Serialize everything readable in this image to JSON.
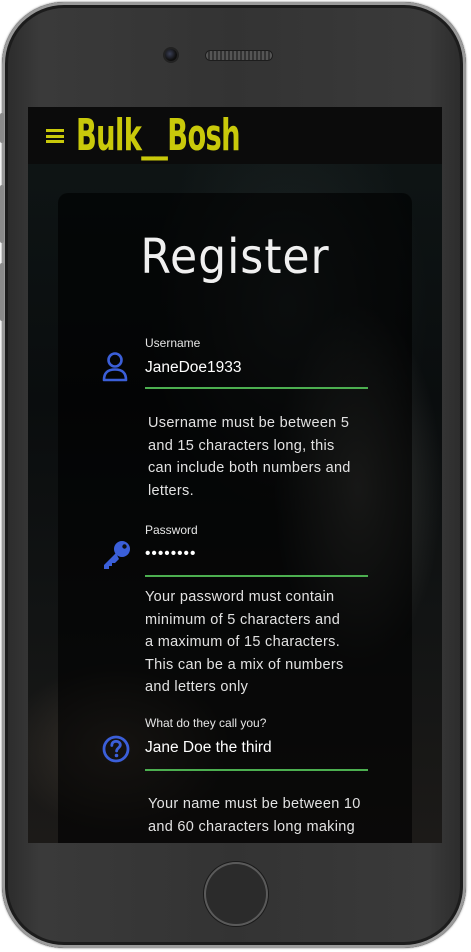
{
  "brand": "Bulk__Bosh",
  "page_title": "Register",
  "form": {
    "username": {
      "label": "Username",
      "value": "JaneDoe1933",
      "hint_lines": [
        "Username must be between 5",
        "and 15 characters long, this",
        "can include both numbers and",
        "letters."
      ]
    },
    "password": {
      "label": "Password",
      "value": "••••••••",
      "hint_lines": [
        "Your password must contain",
        "minimum of 5 characters and",
        "a maximum of 15 characters.",
        "This can be a mix of numbers",
        "and letters only"
      ]
    },
    "name": {
      "label": "What do they call you?",
      "value": "Jane Doe the third",
      "hint_lines": [
        "Your name must be between 10",
        "and 60 characters long making"
      ]
    }
  },
  "colors": {
    "brand": "#c9c90a",
    "icon": "#3b5fd9",
    "underline": "#4caf50"
  },
  "icons": {
    "menu": "hamburger-menu-icon",
    "username": "user-icon",
    "password": "key-icon",
    "name": "question-circle-icon"
  }
}
